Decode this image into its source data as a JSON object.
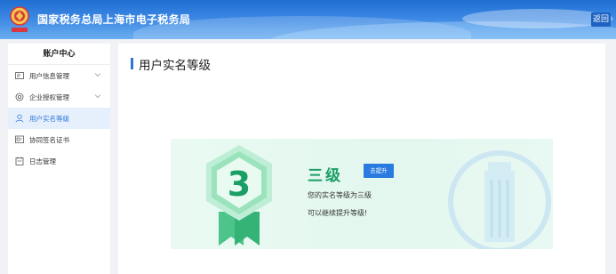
{
  "header": {
    "brand_title": "国家税务总局上海市电子税务局",
    "back_label": "返回"
  },
  "sidebar": {
    "title": "账户中心",
    "items": [
      {
        "label": "用户信息管理",
        "icon": "user-info-icon",
        "expandable": true,
        "active": false
      },
      {
        "label": "企业授权管理",
        "icon": "auth-icon",
        "expandable": true,
        "active": false
      },
      {
        "label": "用户实名等级",
        "icon": "person-icon",
        "expandable": false,
        "active": true
      },
      {
        "label": "协同签名证书",
        "icon": "certificate-icon",
        "expandable": false,
        "active": false
      },
      {
        "label": "日志管理",
        "icon": "log-icon",
        "expandable": false,
        "active": false
      }
    ]
  },
  "main": {
    "page_title": "用户实名等级",
    "level": {
      "badge_number": "3",
      "title": "三级",
      "upgrade_label": "去提升",
      "description": "您的实名等级为三级",
      "note": "可以继续提升等级!"
    }
  },
  "colors": {
    "header_blue": "#1f6fd1",
    "accent_blue": "#2d74d8",
    "level_green": "#1a9e66",
    "active_bg": "#e6f0fc"
  }
}
